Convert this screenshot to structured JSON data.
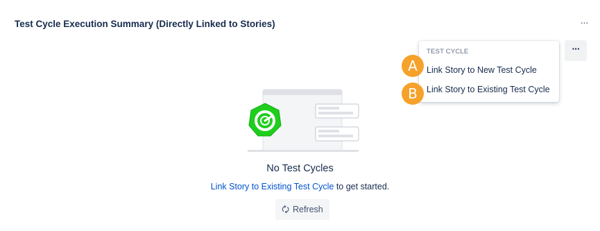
{
  "panel": {
    "title": "Test Cycle Execution Summary (Directly Linked to Stories)",
    "more_label": "···"
  },
  "menu": {
    "button_label": "···",
    "section_label": "TEST CYCLE",
    "items": [
      {
        "label": "Link Story to New Test Cycle",
        "marker": "A"
      },
      {
        "label": "Link Story to Existing Test Cycle",
        "marker": "B"
      }
    ],
    "marker_color": "#f6a12a"
  },
  "empty_state": {
    "illustration_icon": "zephyr-logo-icon",
    "title": "No Test Cycles",
    "message_link": "Link Story to Existing Test Cycle",
    "message_suffix": " to get started."
  },
  "refresh": {
    "icon": "refresh-icon",
    "glyph": "🗘",
    "label": "Refresh"
  },
  "colors": {
    "link": "#0052cc",
    "text": "#172b4d",
    "logo_green": "#1fce1c"
  }
}
